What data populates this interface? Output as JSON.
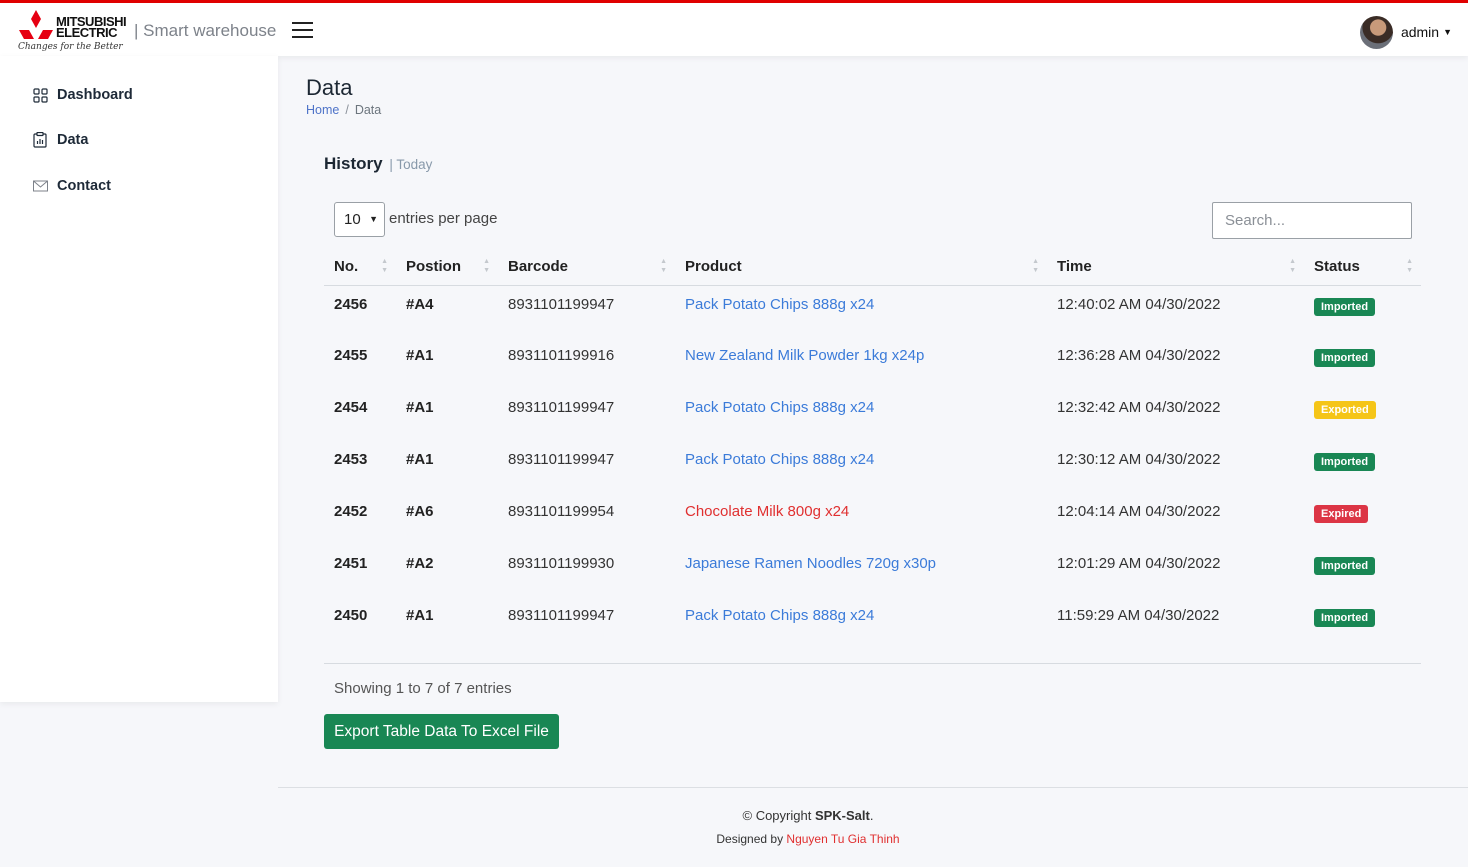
{
  "brand": {
    "logo_line1": "MITSUBISHI",
    "logo_line2": "ELECTRIC",
    "tagline": "Changes for the Better",
    "app_title": "| Smart warehouse",
    "accent_color": "#e00000"
  },
  "user": {
    "name": "admin"
  },
  "sidebar": {
    "items": [
      {
        "label": "Dashboard",
        "icon": "grid-icon"
      },
      {
        "label": "Data",
        "icon": "bar-chart-icon"
      },
      {
        "label": "Contact",
        "icon": "envelope-icon"
      }
    ]
  },
  "page": {
    "title": "Data",
    "breadcrumb": [
      "Home",
      "/",
      "Data"
    ]
  },
  "card": {
    "title": "History",
    "subtitle": "| Today",
    "entries_value": "10",
    "entries_label": "entries per page",
    "search_placeholder": "Search...",
    "columns": [
      "No.",
      "Postion",
      "Barcode",
      "Product",
      "Time",
      "Status"
    ],
    "rows": [
      {
        "no": "2456",
        "pos": "#A4",
        "barcode": "8931101199947",
        "product": "Pack Potato Chips 888g x24",
        "time": "12:40:02 AM 04/30/2022",
        "status": "Imported"
      },
      {
        "no": "2455",
        "pos": "#A1",
        "barcode": "8931101199916",
        "product": "New Zealand Milk Powder 1kg x24p",
        "time": "12:36:28 AM 04/30/2022",
        "status": "Imported"
      },
      {
        "no": "2454",
        "pos": "#A1",
        "barcode": "8931101199947",
        "product": "Pack Potato Chips 888g x24",
        "time": "12:32:42 AM 04/30/2022",
        "status": "Exported"
      },
      {
        "no": "2453",
        "pos": "#A1",
        "barcode": "8931101199947",
        "product": "Pack Potato Chips 888g x24",
        "time": "12:30:12 AM 04/30/2022",
        "status": "Imported"
      },
      {
        "no": "2452",
        "pos": "#A6",
        "barcode": "8931101199954",
        "product": "Chocolate Milk 800g x24",
        "time": "12:04:14 AM 04/30/2022",
        "status": "Expired"
      },
      {
        "no": "2451",
        "pos": "#A2",
        "barcode": "8931101199930",
        "product": "Japanese Ramen Noodles 720g x30p",
        "time": "12:01:29 AM 04/30/2022",
        "status": "Imported"
      },
      {
        "no": "2450",
        "pos": "#A1",
        "barcode": "8931101199947",
        "product": "Pack Potato Chips 888g x24",
        "time": "11:59:29 AM 04/30/2022",
        "status": "Imported"
      }
    ],
    "status_colors": {
      "Imported": "#198754",
      "Exported": "#f5c518",
      "Expired": "#dc3545"
    },
    "showing": "Showing 1 to 7 of 7 entries",
    "export_label": "Export Table Data To Excel File"
  },
  "footer": {
    "copyright_prefix": "© Copyright ",
    "copyright_name": "SPK-Salt",
    "copyright_suffix": ".",
    "designed_prefix": "Designed by ",
    "designer": "Nguyen Tu Gia Thinh"
  }
}
